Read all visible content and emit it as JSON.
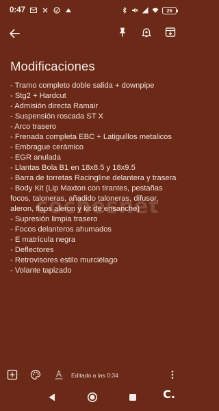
{
  "status_bar": {
    "time": "0:47",
    "battery": "26"
  },
  "note": {
    "title": "Modificaciones",
    "lines": [
      "- Tramo completo doble salida + downpipe",
      "- Stg2 + Hardcut",
      "- Admisión directa Ramair",
      "- Suspensión roscada ST X",
      "- Arco trasero",
      "- Frenada completa EBC + Latiguillos metalicos",
      "- Embrague cerámico",
      "- EGR anulada",
      "- Llantas Bola B1 en 18x8.5 y 18x9.5",
      "- Barra de torretas Racingline delantera y trasera",
      "- Body Kit (Lip Maxton con tirantes, pestañas focos, taloneras, añadido taloneras, difusor, aleron, flaps aleron y kit de ensanche)",
      "- Supresión limpia trasero",
      "- Focos delanteros ahumados",
      "- E matrícula negra",
      "- Deflectores",
      "- Retrovisores estilo murciélago",
      "- Volante tapizado"
    ]
  },
  "watermark": "cochesnet",
  "bottom_bar": {
    "edited_label": "Editado a las 0:34"
  },
  "brand_mark": "C.",
  "colors": {
    "background": "#6b2a17",
    "text": "#efe3de"
  },
  "icons": {
    "back": "arrow-left-icon",
    "pin": "pin-icon",
    "reminder": "bell-plus-icon",
    "archive": "archive-icon",
    "add": "add-box-icon",
    "palette": "palette-icon",
    "text_format": "text-format-icon",
    "more": "more-vert-icon"
  }
}
